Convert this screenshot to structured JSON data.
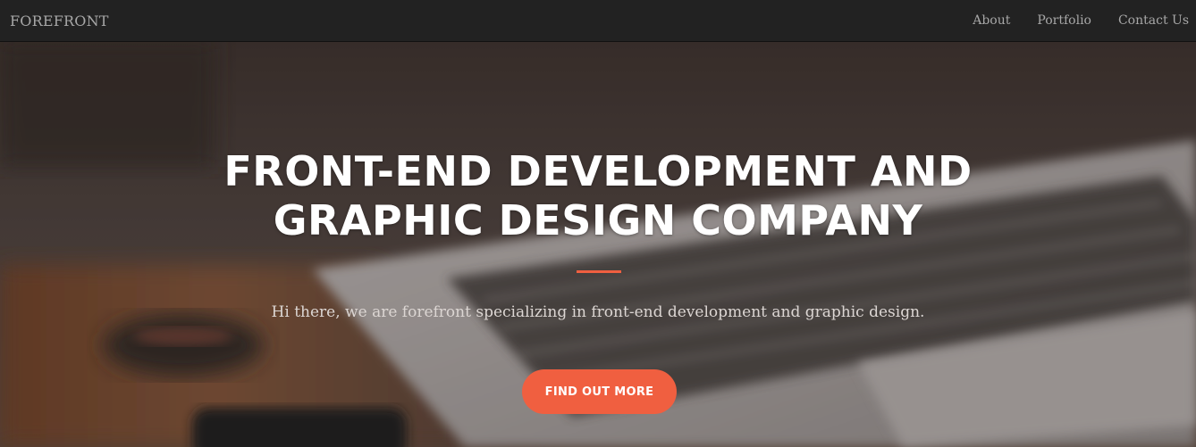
{
  "navbar": {
    "brand": "FOREFRONT",
    "links": [
      "About",
      "Portfolio",
      "Contact Us"
    ]
  },
  "hero": {
    "title_line1": "FRONT-END DEVELOPMENT AND",
    "title_line2": "GRAPHIC DESIGN COMPANY",
    "subtitle": "Hi there, we are forefront specializing in front-end development and graphic design.",
    "cta_label": "FIND OUT MORE"
  },
  "colors": {
    "navbar_bg": "#222222",
    "nav_text": "#a7a7a7",
    "accent": "#f05f40",
    "title_text": "#ffffff"
  }
}
